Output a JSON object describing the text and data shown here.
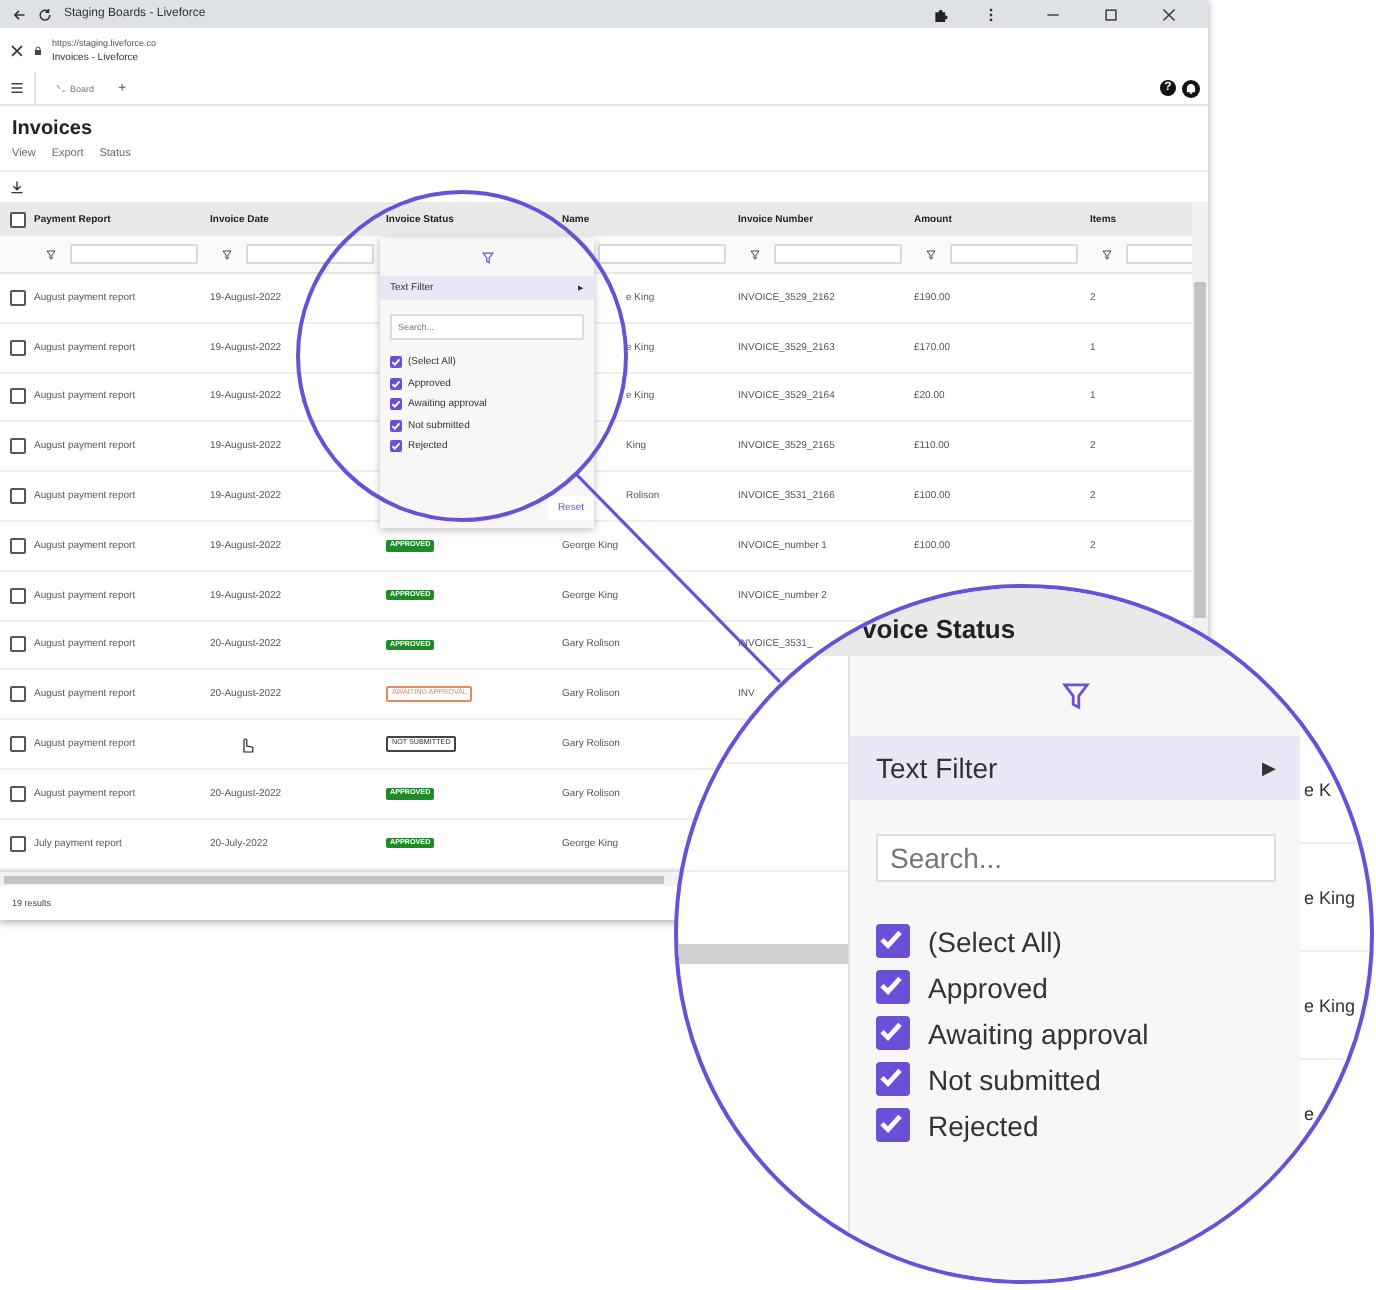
{
  "browser": {
    "page_title": "Staging Boards - Liveforce",
    "url": "https://staging.liveforce.co",
    "tab_title": "Invoices - Liveforce"
  },
  "toolbar": {
    "tab": "Board",
    "add": "+",
    "help": "?"
  },
  "page": {
    "title": "Invoices",
    "menu": [
      "View",
      "Export",
      "Status"
    ]
  },
  "table": {
    "select_all": false,
    "columns": [
      "Payment Report",
      "Invoice Date",
      "Invoice Status",
      "Name",
      "Invoice Number",
      "Amount",
      "Items"
    ],
    "rows": [
      {
        "selected": false,
        "payment_report": "August payment report",
        "invoice_date": "19-August-2022",
        "name": "e King",
        "name_cut": true,
        "invoice_number": "INVOICE_3529_2162",
        "amount": "£190.00",
        "items": "2"
      },
      {
        "selected": false,
        "payment_report": "August payment report",
        "invoice_date": "19-August-2022",
        "name": "e King",
        "name_cut": true,
        "invoice_number": "INVOICE_3529_2163",
        "amount": "£170.00",
        "items": "1"
      },
      {
        "selected": false,
        "payment_report": "August payment report",
        "invoice_date": "19-August-2022",
        "name": "e King",
        "name_cut": true,
        "invoice_number": "INVOICE_3529_2164",
        "amount": "£20.00",
        "items": "1"
      },
      {
        "selected": false,
        "payment_report": "August payment report",
        "invoice_date": "19-August-2022",
        "name": "King",
        "name_cut": true,
        "invoice_number": "INVOICE_3529_2165",
        "amount": "£110.00",
        "items": "2"
      },
      {
        "selected": false,
        "payment_report": "August payment report",
        "invoice_date": "19-August-2022",
        "name": "Rolison",
        "name_cut": true,
        "invoice_number": "INVOICE_3531_2166",
        "amount": "£100.00",
        "items": "2"
      },
      {
        "selected": false,
        "payment_report": "August payment report",
        "invoice_date": "19-August-2022",
        "status": {
          "label": "APPROVED",
          "kind": "approved"
        },
        "name": "George King",
        "invoice_number": "INVOICE_number 1",
        "amount": "£100.00",
        "items": "2"
      },
      {
        "selected": false,
        "payment_report": "August payment report",
        "invoice_date": "19-August-2022",
        "status": {
          "label": "APPROVED",
          "kind": "approved"
        },
        "name": "George King",
        "invoice_number": "INVOICE_number 2"
      },
      {
        "selected": false,
        "payment_report": "August payment report",
        "invoice_date": "20-August-2022",
        "status": {
          "label": "APPROVED",
          "kind": "approved"
        },
        "name": "Gary Rolison",
        "invoice_number": "INVOICE_3531_"
      },
      {
        "selected": false,
        "payment_report": "August payment report",
        "invoice_date": "20-August-2022",
        "status": {
          "label": "AWAITING APPROVAL",
          "kind": "awaiting"
        },
        "name": "Gary Rolison",
        "invoice_number": "INV"
      },
      {
        "selected": false,
        "payment_report": "August payment report",
        "hover": true,
        "status": {
          "label": "NOT SUBMITTED",
          "kind": "not_submitted"
        },
        "name": "Gary Rolison"
      },
      {
        "selected": false,
        "payment_report": "August payment report",
        "invoice_date": "20-August-2022",
        "status": {
          "label": "APPROVED",
          "kind": "approved"
        },
        "name": "Gary Rolison"
      },
      {
        "selected": false,
        "payment_report": "July payment report",
        "invoice_date": "20-July-2022",
        "status": {
          "label": "APPROVED",
          "kind": "approved"
        },
        "name": "George King"
      }
    ]
  },
  "footer": "19 results",
  "filter_popup": {
    "menu_item": "Text Filter",
    "arrow": "▶",
    "search_placeholder": "Search...",
    "reset": "Reset",
    "options": [
      {
        "label": "(Select All)",
        "checked": true
      },
      {
        "label": "Approved",
        "checked": true
      },
      {
        "label": "Awaiting approval",
        "checked": true
      },
      {
        "label": "Not submitted",
        "checked": true
      },
      {
        "label": "Rejected",
        "checked": true
      }
    ]
  },
  "magnifier": {
    "heading": "voice Status",
    "menu_item": "Text Filter",
    "arrow": "▶",
    "search_placeholder": "Search...",
    "options": [
      {
        "label": "(Select All)",
        "checked": true
      },
      {
        "label": "Approved",
        "checked": true
      },
      {
        "label": "Awaiting approval",
        "checked": true
      },
      {
        "label": "Not submitted",
        "checked": true
      },
      {
        "label": "Rejected",
        "checked": true
      }
    ],
    "background_names": [
      "e K",
      "e King",
      "e King",
      "e"
    ]
  }
}
